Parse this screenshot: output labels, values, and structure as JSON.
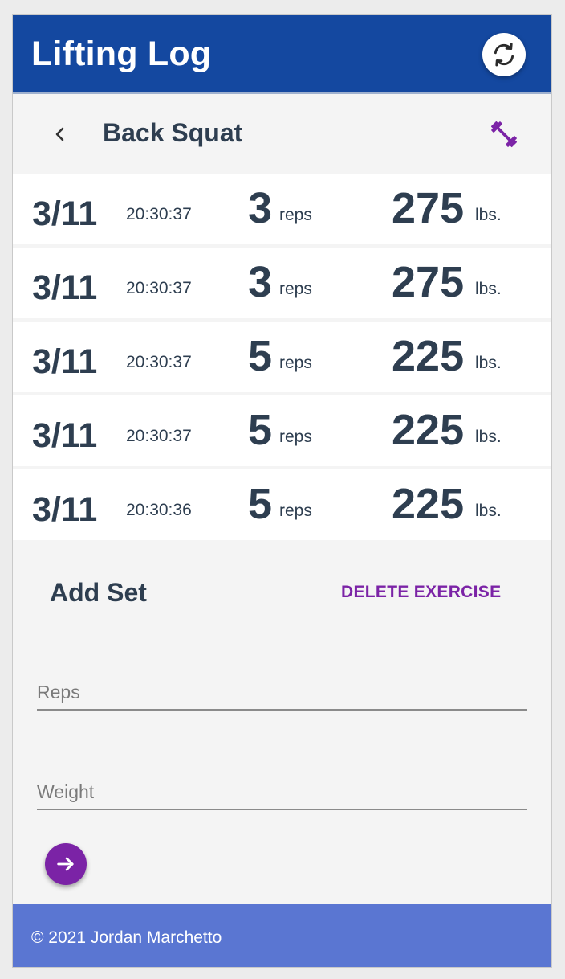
{
  "header": {
    "title": "Lifting Log",
    "sync_icon": "sync-icon"
  },
  "exercise": {
    "back_icon": "chevron-left-icon",
    "name": "Back Squat",
    "action_icon": "dumbbell-icon"
  },
  "sets": [
    {
      "date": "3/11",
      "time": "20:30:37",
      "reps": "3",
      "reps_unit": "reps",
      "weight": "275",
      "weight_unit": "lbs."
    },
    {
      "date": "3/11",
      "time": "20:30:37",
      "reps": "3",
      "reps_unit": "reps",
      "weight": "275",
      "weight_unit": "lbs."
    },
    {
      "date": "3/11",
      "time": "20:30:37",
      "reps": "5",
      "reps_unit": "reps",
      "weight": "225",
      "weight_unit": "lbs."
    },
    {
      "date": "3/11",
      "time": "20:30:37",
      "reps": "5",
      "reps_unit": "reps",
      "weight": "225",
      "weight_unit": "lbs."
    },
    {
      "date": "3/11",
      "time": "20:30:36",
      "reps": "5",
      "reps_unit": "reps",
      "weight": "225",
      "weight_unit": "lbs."
    }
  ],
  "add_set": {
    "title": "Add Set",
    "delete_label": "DELETE EXERCISE",
    "reps_placeholder": "Reps",
    "weight_placeholder": "Weight",
    "submit_icon": "arrow-right-icon"
  },
  "footer": {
    "text": "© 2021 Jordan Marchetto"
  },
  "colors": {
    "header_bg": "#1448a0",
    "accent": "#7b23a6",
    "footer_bg": "#5a76d2",
    "text": "#2e3e50"
  }
}
